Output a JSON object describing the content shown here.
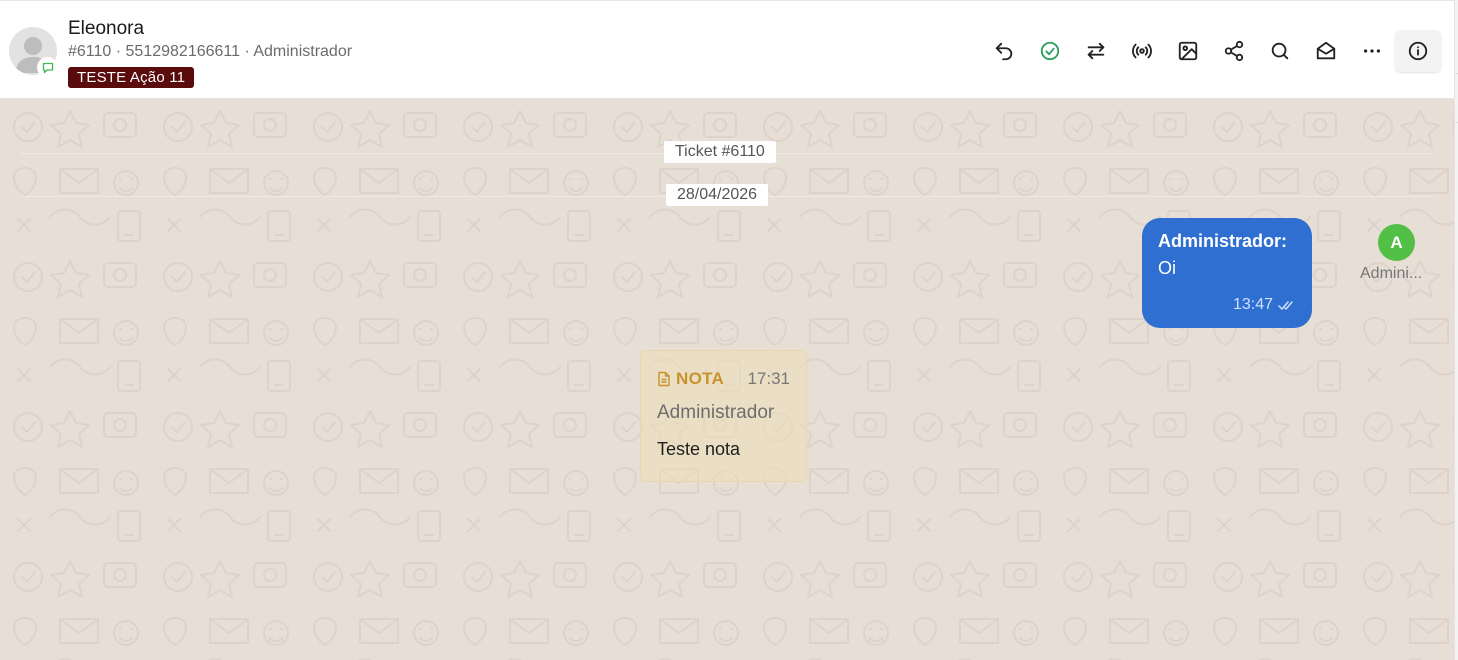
{
  "header": {
    "contact_name": "Eleonora",
    "contact_meta": "#6110 · 5512982166611 · Administrador",
    "tag_label": "TESTE Ação 11",
    "tag_color": "#5a0b0b",
    "toolbar_icons": [
      "undo-icon",
      "check-circle-icon",
      "transfer-icon",
      "broadcast-icon",
      "image-icon",
      "share-icon",
      "search-icon",
      "mail-open-icon",
      "more-icon",
      "info-icon"
    ]
  },
  "chat": {
    "ticket_label": "Ticket #6110",
    "date_label": "28/04/2026",
    "messages": [
      {
        "sender": "Administrador",
        "sender_suffix": ":",
        "text": "Oi",
        "time": "13:47",
        "avatar_initial": "A",
        "avatar_label": "Admini...",
        "bubble_color": "#2f6fd1",
        "avatar_color": "#52bf47"
      }
    ],
    "note": {
      "label": "NOTA",
      "time": "17:31",
      "author": "Administrador",
      "text": "Teste nota",
      "accent_color": "#c8932a"
    }
  }
}
